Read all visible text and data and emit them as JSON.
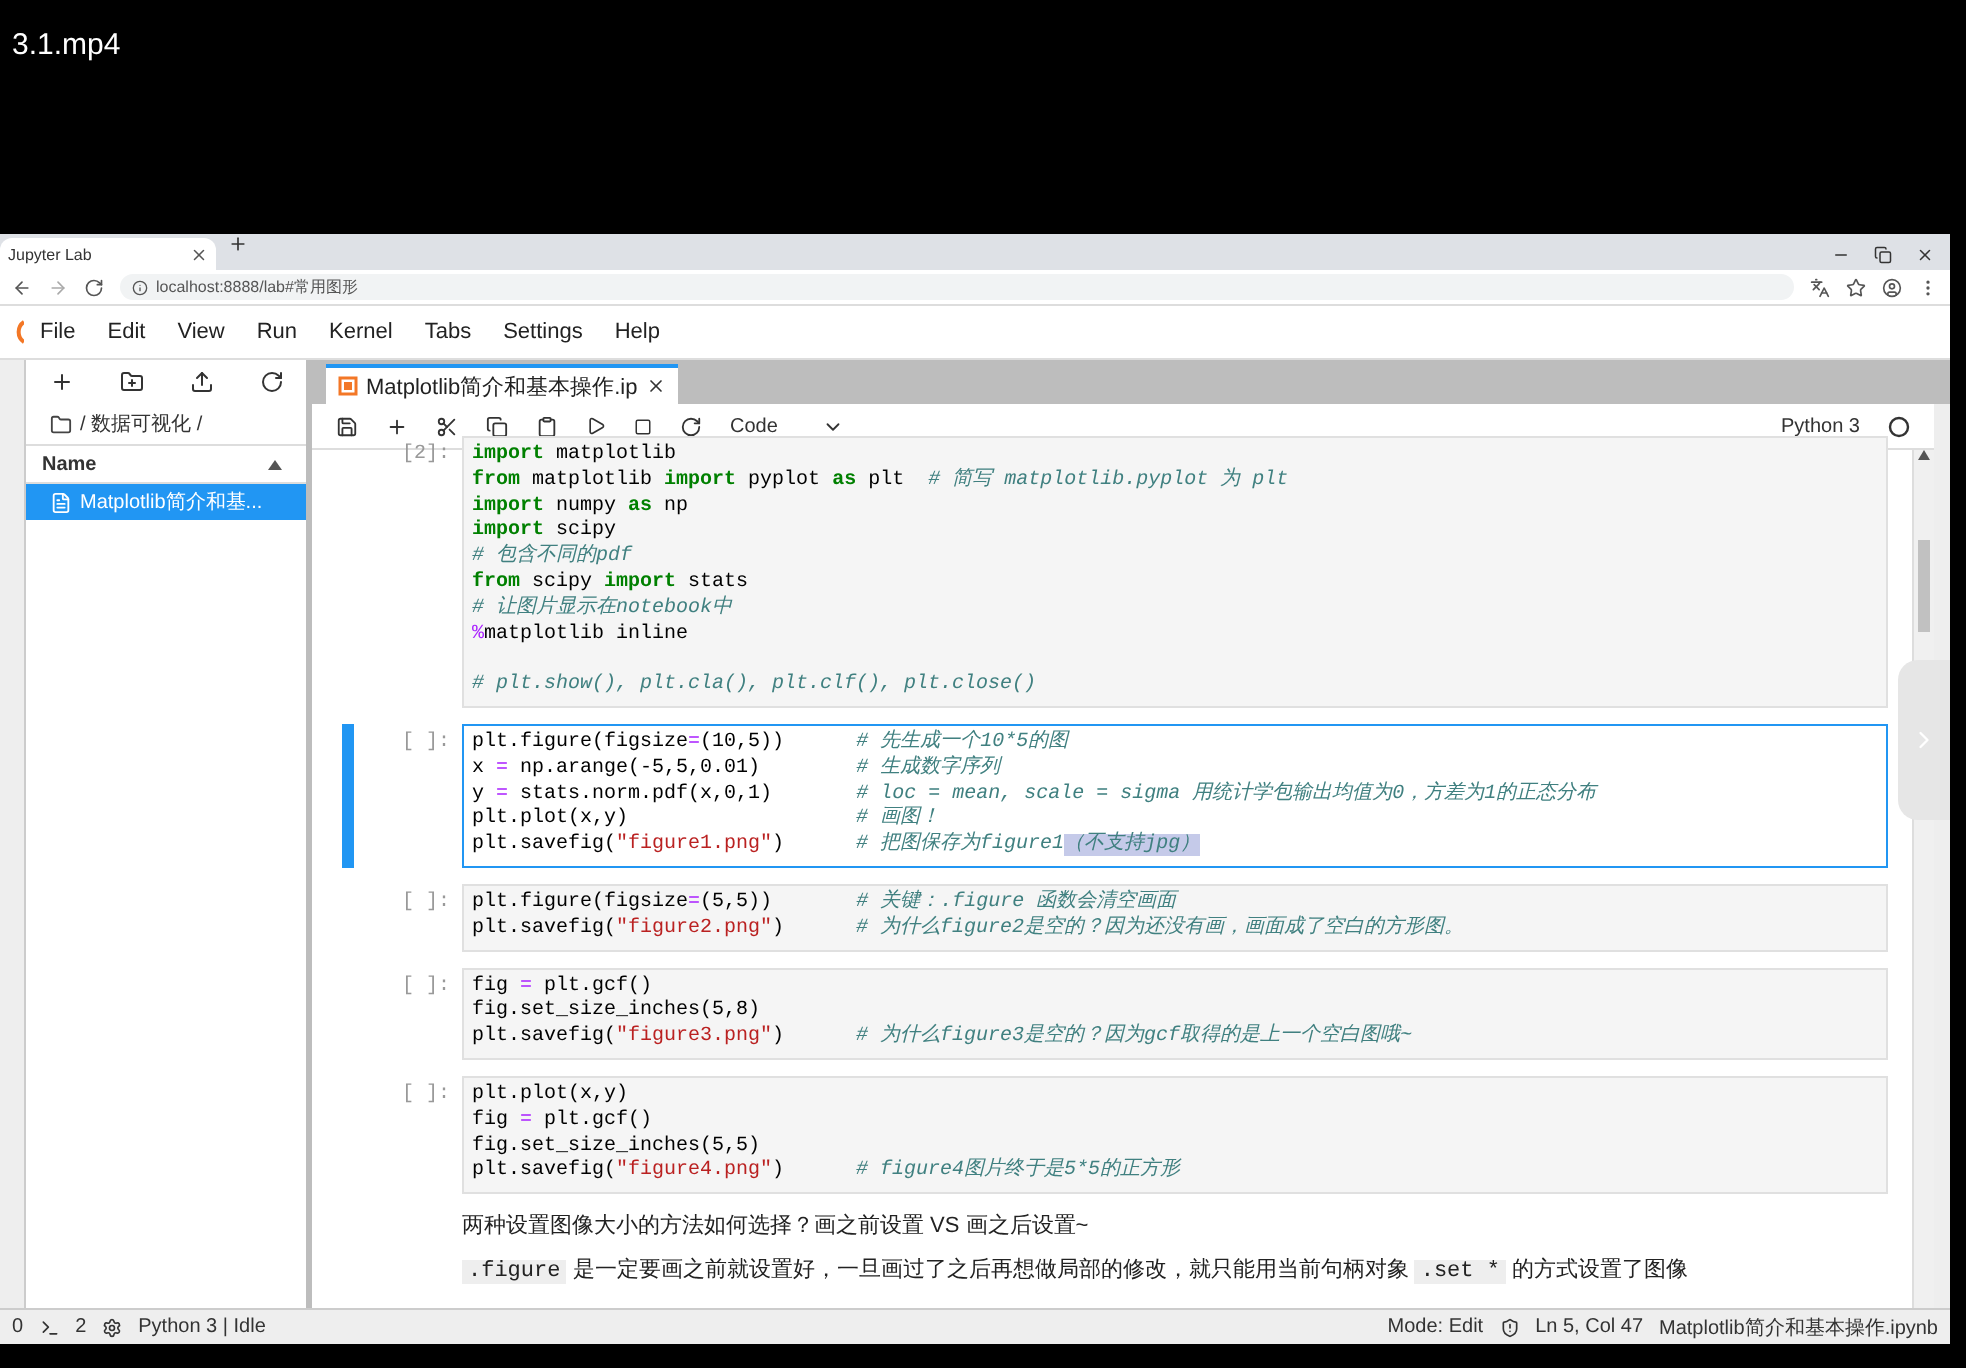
{
  "video": {
    "title": "3.1.mp4"
  },
  "browser": {
    "tab": "Jupyter Lab",
    "url": "localhost:8888/lab#常用图形"
  },
  "menu": [
    "File",
    "Edit",
    "View",
    "Run",
    "Kernel",
    "Tabs",
    "Settings",
    "Help"
  ],
  "file_browser": {
    "path": "/ 数据可视化 /",
    "column": "Name",
    "items": [
      {
        "name": "Matplotlib简介和基...",
        "selected": true
      }
    ]
  },
  "notebook": {
    "tab": "Matplotlib简介和基本操作.ip",
    "cell_type": "Code",
    "kernel": "Python 3",
    "cells": [
      {
        "prompt": "[2]:",
        "selected": false,
        "lines": [
          {
            "kind": "code",
            "tokens": [
              {
                "kind": "keyword",
                "text": "import"
              },
              {
                "kind": "name",
                "text": " matplotlib"
              }
            ]
          },
          {
            "kind": "code",
            "tokens": [
              {
                "kind": "keyword",
                "text": "from"
              },
              {
                "kind": "name",
                "text": " matplotlib "
              },
              {
                "kind": "keyword",
                "text": "import"
              },
              {
                "kind": "name",
                "text": " pyplot "
              },
              {
                "kind": "keyword",
                "text": "as"
              },
              {
                "kind": "name",
                "text": " plt  "
              },
              {
                "kind": "comment",
                "text": "# 简写 matplotlib.pyplot 为 plt"
              }
            ]
          },
          {
            "kind": "code",
            "tokens": [
              {
                "kind": "keyword",
                "text": "import"
              },
              {
                "kind": "name",
                "text": " numpy "
              },
              {
                "kind": "keyword",
                "text": "as"
              },
              {
                "kind": "name",
                "text": " np"
              }
            ]
          },
          {
            "kind": "code",
            "tokens": [
              {
                "kind": "keyword",
                "text": "import"
              },
              {
                "kind": "name",
                "text": " scipy"
              }
            ]
          },
          {
            "kind": "code",
            "tokens": [
              {
                "kind": "comment",
                "text": "# 包含不同的pdf"
              }
            ]
          },
          {
            "kind": "code",
            "tokens": [
              {
                "kind": "keyword",
                "text": "from"
              },
              {
                "kind": "name",
                "text": " scipy "
              },
              {
                "kind": "keyword",
                "text": "import"
              },
              {
                "kind": "name",
                "text": " stats"
              }
            ]
          },
          {
            "kind": "code",
            "tokens": [
              {
                "kind": "comment",
                "text": "# 让图片显示在notebook中"
              }
            ]
          },
          {
            "kind": "code",
            "tokens": [
              {
                "kind": "operator",
                "text": "%"
              },
              {
                "kind": "name",
                "text": "matplotlib inline"
              }
            ]
          },
          {
            "kind": "blank"
          },
          {
            "kind": "code",
            "tokens": [
              {
                "kind": "comment",
                "text": "# plt.show(), plt.cla(), plt.clf(), plt.close()"
              }
            ]
          }
        ]
      },
      {
        "prompt": "[ ]:",
        "selected": true,
        "lines": [
          {
            "kind": "code",
            "tokens": [
              {
                "kind": "name",
                "text": "plt.figure(figsize"
              },
              {
                "kind": "operator",
                "text": "="
              },
              {
                "kind": "name",
                "text": "(10,5))      "
              },
              {
                "kind": "comment",
                "text": "# 先生成一个10*5的图"
              }
            ]
          },
          {
            "kind": "code",
            "tokens": [
              {
                "kind": "name",
                "text": "x "
              },
              {
                "kind": "operator",
                "text": "="
              },
              {
                "kind": "name",
                "text": " np.arange(-5,5,0.01)        "
              },
              {
                "kind": "comment",
                "text": "# 生成数字序列"
              }
            ]
          },
          {
            "kind": "code",
            "tokens": [
              {
                "kind": "name",
                "text": "y "
              },
              {
                "kind": "operator",
                "text": "="
              },
              {
                "kind": "name",
                "text": " stats.norm.pdf(x,0,1)       "
              },
              {
                "kind": "comment",
                "text": "# loc = mean, scale = sigma 用统计学包输出均值为0，方差为1的正态分布"
              }
            ]
          },
          {
            "kind": "code",
            "tokens": [
              {
                "kind": "name",
                "text": "plt.plot(x,y)                   "
              },
              {
                "kind": "comment",
                "text": "# 画图！"
              }
            ]
          },
          {
            "kind": "code",
            "tokens": [
              {
                "kind": "name",
                "text": "plt.savefig("
              },
              {
                "kind": "string",
                "text": "\"figure1.png\""
              },
              {
                "kind": "name",
                "text": ")      "
              },
              {
                "kind": "comment",
                "text": "# 把图保存为figure1"
              },
              {
                "kind": "highlight",
                "text": "（不支持jpg）"
              }
            ]
          }
        ]
      },
      {
        "prompt": "[ ]:",
        "selected": false,
        "lines": [
          {
            "kind": "code",
            "tokens": [
              {
                "kind": "name",
                "text": "plt.figure(figsize"
              },
              {
                "kind": "operator",
                "text": "="
              },
              {
                "kind": "name",
                "text": "(5,5))       "
              },
              {
                "kind": "comment",
                "text": "# 关键：.figure 函数会清空画面"
              }
            ]
          },
          {
            "kind": "code",
            "tokens": [
              {
                "kind": "name",
                "text": "plt.savefig("
              },
              {
                "kind": "string",
                "text": "\"figure2.png\""
              },
              {
                "kind": "name",
                "text": ")      "
              },
              {
                "kind": "comment",
                "text": "# 为什么figure2是空的？因为还没有画，画面成了空白的方形图。"
              }
            ]
          }
        ]
      },
      {
        "prompt": "[ ]:",
        "selected": false,
        "lines": [
          {
            "kind": "code",
            "tokens": [
              {
                "kind": "name",
                "text": "fig "
              },
              {
                "kind": "operator",
                "text": "="
              },
              {
                "kind": "name",
                "text": " plt.gcf()"
              }
            ]
          },
          {
            "kind": "code",
            "tokens": [
              {
                "kind": "name",
                "text": "fig.set_size_inches(5,8)"
              }
            ]
          },
          {
            "kind": "code",
            "tokens": [
              {
                "kind": "name",
                "text": "plt.savefig("
              },
              {
                "kind": "string",
                "text": "\"figure3.png\""
              },
              {
                "kind": "name",
                "text": ")      "
              },
              {
                "kind": "comment",
                "text": "# 为什么figure3是空的？因为gcf取得的是上一个空白图哦~"
              }
            ]
          }
        ]
      },
      {
        "prompt": "[ ]:",
        "selected": false,
        "lines": [
          {
            "kind": "code",
            "tokens": [
              {
                "kind": "name",
                "text": "plt.plot(x,y)"
              }
            ]
          },
          {
            "kind": "code",
            "tokens": [
              {
                "kind": "name",
                "text": "fig "
              },
              {
                "kind": "operator",
                "text": "="
              },
              {
                "kind": "name",
                "text": " plt.gcf()"
              }
            ]
          },
          {
            "kind": "code",
            "tokens": [
              {
                "kind": "name",
                "text": "fig.set_size_inches(5,5)"
              }
            ]
          },
          {
            "kind": "code",
            "tokens": [
              {
                "kind": "name",
                "text": "plt.savefig("
              },
              {
                "kind": "string",
                "text": "\"figure4.png\""
              },
              {
                "kind": "name",
                "text": ")      "
              },
              {
                "kind": "comment",
                "text": "# figure4图片终于是5*5的正方形"
              }
            ]
          }
        ]
      }
    ],
    "markdown": [
      [
        {
          "kind": "text",
          "text": "两种设置图像大小的方法如何选择？画之前设置 VS 画之后设置~"
        }
      ],
      [
        {
          "kind": "code",
          "text": ".figure"
        },
        {
          "kind": "text",
          "text": " 是一定要画之前就设置好，一旦画过了之后再想做局部的修改，就只能用当前句柄对象 "
        },
        {
          "kind": "code",
          "text": ".set *"
        },
        {
          "kind": "text",
          "text": " 的方式设置了图像"
        }
      ]
    ]
  },
  "status": {
    "terminals": "0",
    "kernels": "2",
    "kernel_state": "Python 3 | Idle",
    "mode": "Mode: Edit",
    "cursor": "Ln 5, Col 47",
    "file": "Matplotlib简介和基本操作.ipynb"
  }
}
